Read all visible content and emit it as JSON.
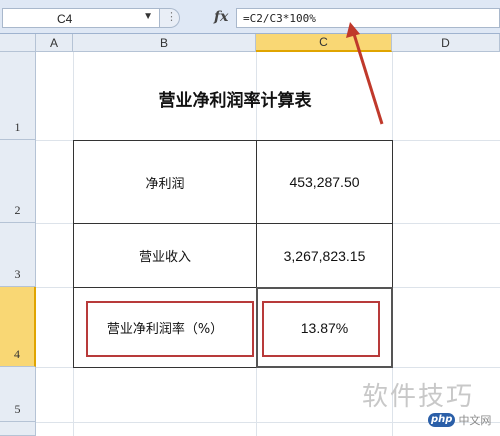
{
  "formula_bar": {
    "name_box": "C4",
    "fx": "fx",
    "formula": "=C2/C3*100%"
  },
  "columns": [
    "A",
    "B",
    "C",
    "D"
  ],
  "rows": [
    "1",
    "2",
    "3",
    "4",
    "5"
  ],
  "selected_cell": "C4",
  "sheet": {
    "title": "营业净利润率计算表",
    "table": [
      {
        "label": "净利润",
        "value": "453,287.50"
      },
      {
        "label": "营业收入",
        "value": "3,267,823.15"
      },
      {
        "label": "营业净利润率（%）",
        "value": "13.87%"
      }
    ]
  },
  "colors": {
    "highlight_box": "#b83a3a",
    "arrow": "#c0392b",
    "selected_header": "#f9d774"
  },
  "watermark": {
    "text": "软件技巧",
    "logo": "php",
    "site": "中文网"
  }
}
